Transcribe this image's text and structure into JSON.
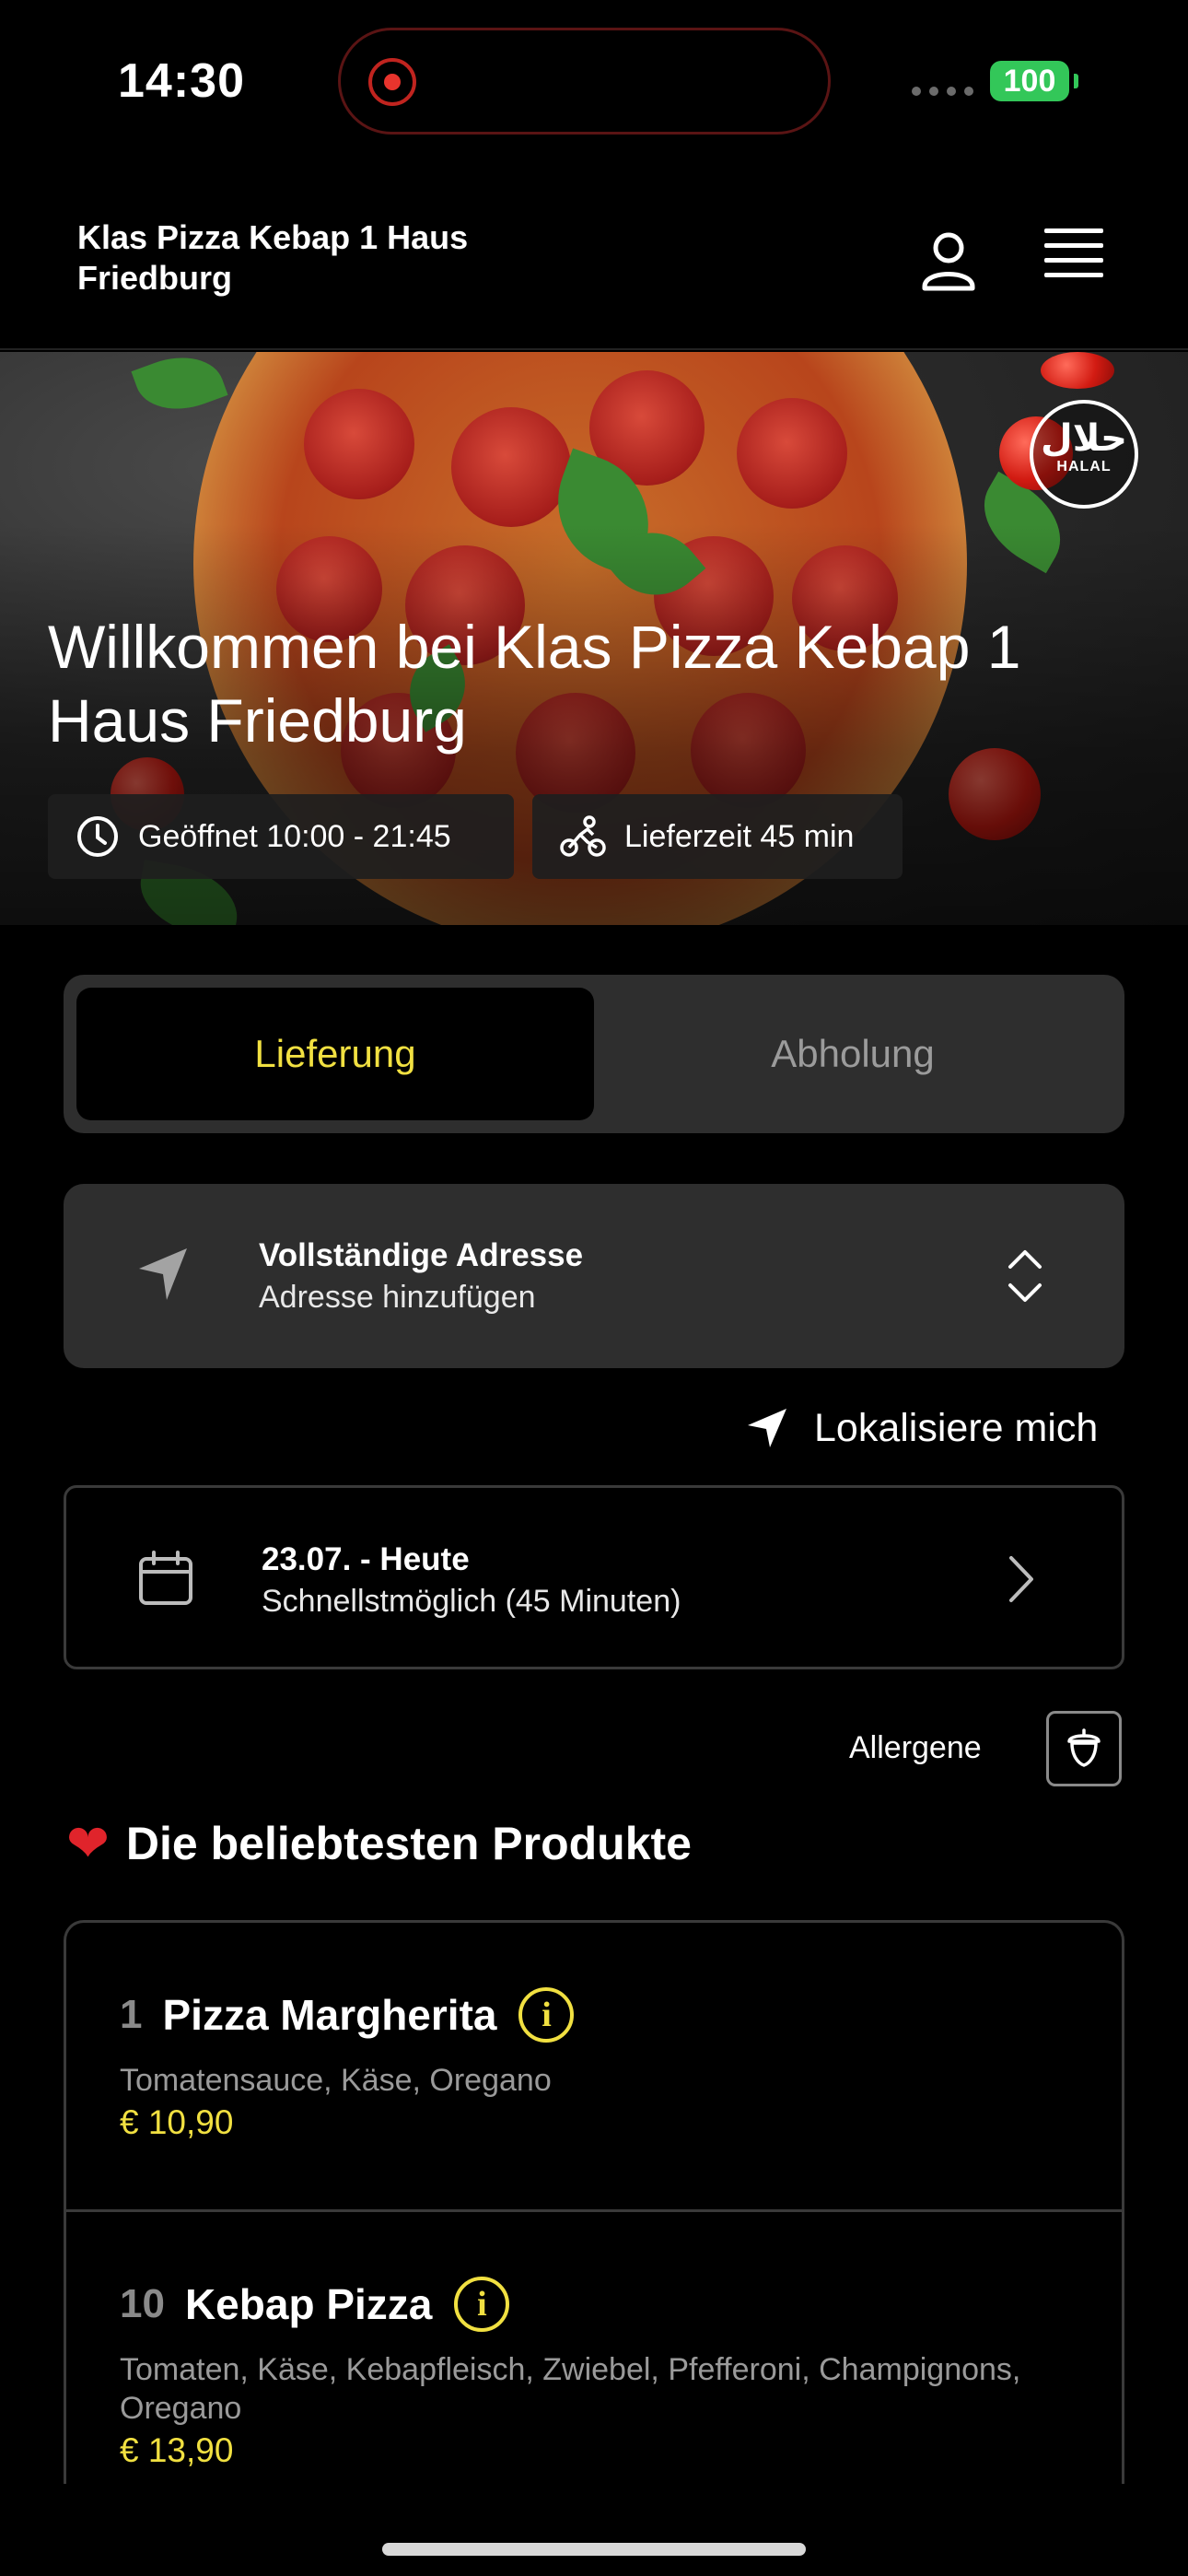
{
  "status_bar": {
    "time": "14:30",
    "battery": "100"
  },
  "header": {
    "restaurant_name": "Klas Pizza Kebap 1 Haus Friedburg"
  },
  "hero": {
    "welcome": "Willkommen bei Klas Pizza Kebap 1 Haus Friedburg",
    "halal_arabic": "حلال",
    "halal_label": "HALAL",
    "opening_hours": "Geöffnet 10:00 - 21:45",
    "delivery_time": "Lieferzeit 45 min"
  },
  "order_mode": {
    "delivery": "Lieferung",
    "pickup": "Abholung",
    "selected": "delivery",
    "accent_color": "#f1e041"
  },
  "address": {
    "title": "Vollständige Adresse",
    "placeholder": "Adresse hinzufügen"
  },
  "locate": {
    "label": "Lokalisiere mich"
  },
  "schedule": {
    "date": "23.07. - Heute",
    "time": "Schnellstmöglich (45 Minuten)"
  },
  "allergens": {
    "label": "Allergene"
  },
  "popular": {
    "title": "Die beliebtesten Produkte",
    "products": [
      {
        "number": "1",
        "name": "Pizza Margherita",
        "description": "Tomatensauce, Käse, Oregano",
        "price": "€ 10,90"
      },
      {
        "number": "10",
        "name": "Kebap Pizza",
        "description": "Tomaten, Käse, Kebapfleisch, Zwiebel, Pfefferoni, Champignons, Oregano",
        "price": "€ 13,90"
      }
    ]
  }
}
